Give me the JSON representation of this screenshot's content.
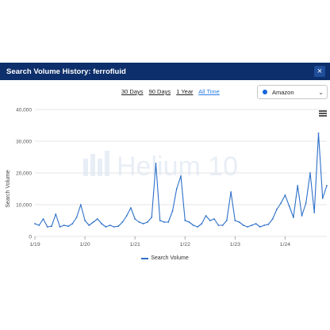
{
  "header": {
    "title": "Search Volume History: ferrofluid",
    "close_label": "×"
  },
  "ranges": [
    {
      "label": "30 Days",
      "active": false
    },
    {
      "label": "90 Days",
      "active": false
    },
    {
      "label": "1 Year",
      "active": false
    },
    {
      "label": "All Time",
      "active": true
    }
  ],
  "marketplace": {
    "selected": "Amazon"
  },
  "watermark": "Helium 10",
  "icons": {
    "close": "close-icon",
    "menu": "hamburger-menu-icon",
    "dropdown": "chevron-down-icon"
  },
  "colors": {
    "header_bg": "#0d2f6b",
    "series": "#2d6fc8",
    "active_link": "#2a7be4"
  },
  "chart_data": {
    "type": "line",
    "title": "",
    "xlabel": "",
    "ylabel": "Search Volume",
    "ylim": [
      0,
      40000
    ],
    "yticks": [
      0,
      10000,
      20000,
      30000,
      40000
    ],
    "ytick_labels": [
      "0",
      "10,000",
      "20,000",
      "30,000",
      "40,000"
    ],
    "x_range": [
      "2019-01",
      "2024-11"
    ],
    "xticks": [
      "2019-01",
      "2020-01",
      "2021-01",
      "2022-01",
      "2023-01",
      "2024-01"
    ],
    "xtick_labels": [
      "1/19",
      "1/20",
      "1/21",
      "1/22",
      "1/23",
      "1/24"
    ],
    "grid": true,
    "legend_position": "bottom",
    "series": [
      {
        "name": "Search Volume",
        "x": [
          "2019-01",
          "2019-02",
          "2019-03",
          "2019-04",
          "2019-05",
          "2019-06",
          "2019-07",
          "2019-08",
          "2019-09",
          "2019-10",
          "2019-11",
          "2019-12",
          "2020-01",
          "2020-02",
          "2020-03",
          "2020-04",
          "2020-05",
          "2020-06",
          "2020-07",
          "2020-08",
          "2020-09",
          "2020-10",
          "2020-11",
          "2020-12",
          "2021-01",
          "2021-02",
          "2021-03",
          "2021-04",
          "2021-05",
          "2021-06",
          "2021-07",
          "2021-08",
          "2021-09",
          "2021-10",
          "2021-11",
          "2021-12",
          "2022-01",
          "2022-02",
          "2022-03",
          "2022-04",
          "2022-05",
          "2022-06",
          "2022-07",
          "2022-08",
          "2022-09",
          "2022-10",
          "2022-11",
          "2022-12",
          "2023-01",
          "2023-02",
          "2023-03",
          "2023-04",
          "2023-05",
          "2023-06",
          "2023-07",
          "2023-08",
          "2023-09",
          "2023-10",
          "2023-11",
          "2023-12",
          "2024-01",
          "2024-02",
          "2024-03",
          "2024-04",
          "2024-05",
          "2024-06",
          "2024-07",
          "2024-08",
          "2024-09",
          "2024-10",
          "2024-11"
        ],
        "values": [
          4000,
          3500,
          5500,
          3000,
          3200,
          7000,
          3000,
          3500,
          3200,
          4000,
          6000,
          10000,
          5000,
          3500,
          4500,
          5500,
          4000,
          3000,
          3500,
          3000,
          3200,
          4500,
          6500,
          9000,
          5500,
          4500,
          4000,
          4500,
          6000,
          23000,
          5000,
          4500,
          4500,
          8000,
          15000,
          19000,
          5000,
          4500,
          3500,
          3000,
          4000,
          6500,
          5000,
          5500,
          3500,
          3500,
          5000,
          14000,
          5000,
          4500,
          3500,
          3000,
          3500,
          4000,
          3000,
          3500,
          3800,
          5500,
          8500,
          10500,
          13000,
          9500,
          6000,
          16000,
          6500,
          10500,
          20000,
          7500,
          32500,
          12000,
          16000
        ]
      }
    ]
  }
}
